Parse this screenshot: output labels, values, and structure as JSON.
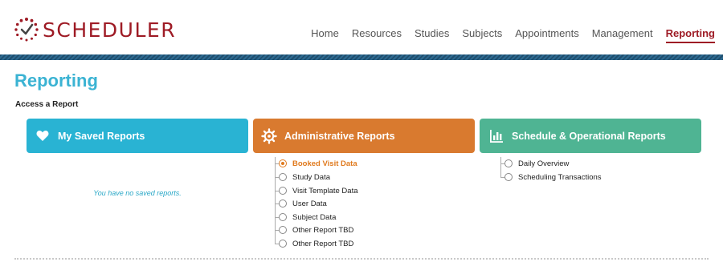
{
  "app": {
    "name": "SCHEDULER",
    "brand_color": "#9e1b25"
  },
  "nav": {
    "items": [
      {
        "label": "Home",
        "active": false
      },
      {
        "label": "Resources",
        "active": false
      },
      {
        "label": "Studies",
        "active": false
      },
      {
        "label": "Subjects",
        "active": false
      },
      {
        "label": "Appointments",
        "active": false
      },
      {
        "label": "Management",
        "active": false
      },
      {
        "label": "Reporting",
        "active": true
      }
    ]
  },
  "page": {
    "title": "Reporting",
    "subheading": "Access a Report"
  },
  "cards": {
    "saved": {
      "title": "My Saved Reports",
      "icon": "heart-icon",
      "color": "#29b3d3",
      "empty_text": "You have no saved reports."
    },
    "admin": {
      "title": "Administrative Reports",
      "icon": "gear-icon",
      "color": "#d97a2f"
    },
    "sched": {
      "title": "Schedule & Operational Reports",
      "icon": "bar-chart-icon",
      "color": "#4fb493"
    }
  },
  "admin_reports": [
    {
      "label": "Booked Visit Data",
      "selected": true
    },
    {
      "label": "Study Data",
      "selected": false
    },
    {
      "label": "Visit Template Data",
      "selected": false
    },
    {
      "label": "User Data",
      "selected": false
    },
    {
      "label": "Subject Data",
      "selected": false
    },
    {
      "label": "Other Report TBD",
      "selected": false
    },
    {
      "label": "Other Report TBD",
      "selected": false
    }
  ],
  "sched_reports": [
    {
      "label": "Daily Overview",
      "selected": false
    },
    {
      "label": "Scheduling Transactions",
      "selected": false
    }
  ]
}
